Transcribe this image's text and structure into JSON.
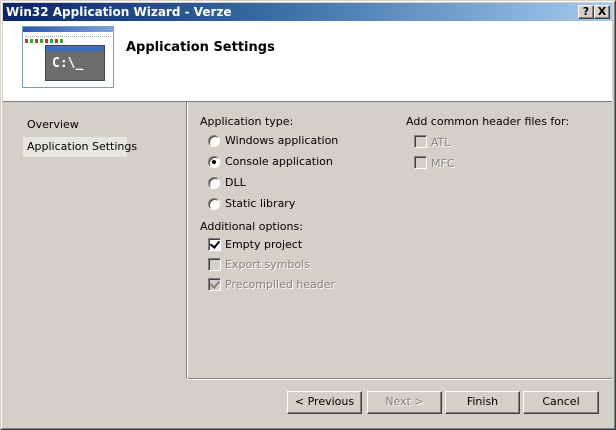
{
  "window": {
    "title": "Win32 Application Wizard - Verze"
  },
  "titlebar_buttons": {
    "help": "?",
    "close": "X"
  },
  "header": {
    "title": "Application Settings",
    "thumbnail_text": "C:\\_"
  },
  "nav": {
    "items": [
      {
        "label": "Overview"
      },
      {
        "label": "Application Settings"
      }
    ]
  },
  "app_type": {
    "heading": "Application type:",
    "options": [
      {
        "label": "Windows application",
        "selected": false
      },
      {
        "label": "Console application",
        "selected": true
      },
      {
        "label": "DLL",
        "selected": false
      },
      {
        "label": "Static library",
        "selected": false
      }
    ]
  },
  "additional": {
    "heading": "Additional options:",
    "options": [
      {
        "label": "Empty project",
        "checked": true,
        "enabled": true
      },
      {
        "label": "Export symbols",
        "checked": false,
        "enabled": false
      },
      {
        "label": "Precompiled header",
        "checked": true,
        "enabled": false
      }
    ]
  },
  "headers": {
    "heading": "Add common header files for:",
    "options": [
      {
        "label": "ATL",
        "checked": false,
        "enabled": false
      },
      {
        "label": "MFC",
        "checked": false,
        "enabled": false
      }
    ]
  },
  "buttons": {
    "previous": "< Previous",
    "next": "Next >",
    "finish": "Finish",
    "cancel": "Cancel"
  },
  "colors": {
    "titlebar_start": "#0a246a",
    "titlebar_end": "#a6caf0",
    "face": "#d4d0c8"
  }
}
